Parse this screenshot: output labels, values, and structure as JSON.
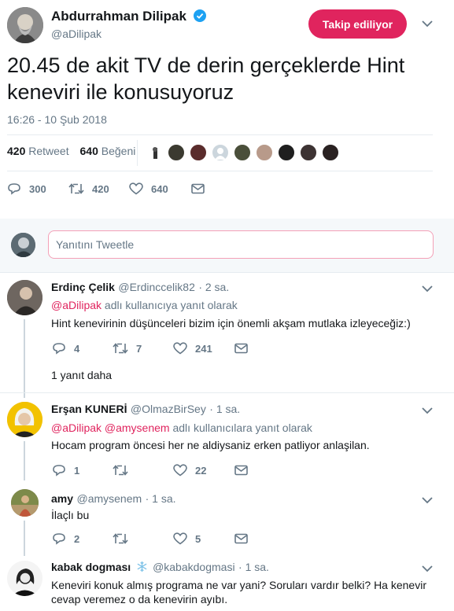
{
  "tweet": {
    "author_name": "Abdurrahman Dilipak",
    "author_handle": "@aDilipak",
    "follow_label": "Takip ediliyor",
    "text": "20.45 de akit TV de derin gerçeklerde Hint keneviri ile konusuyoruz",
    "timestamp": "16:26 - 10 Şub 2018",
    "retweet_count": "420",
    "retweet_label": "Retweet",
    "like_count": "640",
    "like_label": "Beğeni",
    "actions": {
      "reply": "300",
      "retweet": "420",
      "like": "640"
    }
  },
  "composer": {
    "placeholder": "Yanıtını Tweetle"
  },
  "replies": [
    {
      "name": "Erdinç Çelik",
      "handle": "@Erdinccelik82",
      "time": "· 2 sa.",
      "reply_to_users": "@aDilipak",
      "reply_to_suffix": "adlı kullanıcıya yanıt olarak",
      "text": "Hint kenevirinin düşünceleri bizim için önemli akşam mutlaka izleyeceğiz:)",
      "counts": {
        "reply": "4",
        "retweet": "7",
        "like": "241"
      },
      "more_replies": "1 yanıt daha"
    },
    {
      "name": "Erşan KUNERİ",
      "handle": "@OlmazBirSey",
      "time": "· 1 sa.",
      "reply_to_users": "@aDilipak @amysenem",
      "reply_to_suffix": "adlı kullanıcılara yanıt olarak",
      "text": "Hocam program öncesi her ne aldiysaniz erken patliyor anlaşilan.",
      "counts": {
        "reply": "1",
        "retweet": "",
        "like": "22"
      }
    },
    {
      "name": "amy",
      "handle": "@amysenem",
      "time": "· 1 sa.",
      "text": "İlaçlı bu",
      "counts": {
        "reply": "2",
        "retweet": "",
        "like": "5"
      }
    },
    {
      "name": "kabak dogması",
      "handle": "@kabakdogmasi",
      "time": "· 1 sa.",
      "text_line1": "Keneviri konuk almış programa ne var yani? Soruları vardır belki? Ha kenevir",
      "text_line2": "cevap veremez o da kenevirin ayıbı."
    }
  ],
  "colors": {
    "accent": "#e0245e",
    "muted": "#657786",
    "verified": "#1da1f2"
  }
}
